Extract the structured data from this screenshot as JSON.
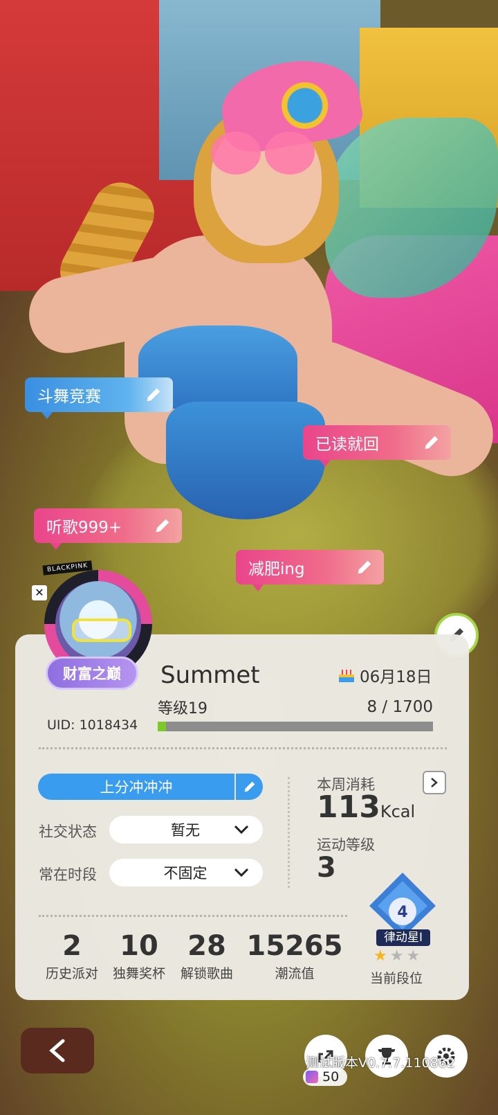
{
  "tags": {
    "tag1": "斗舞竞赛",
    "tag2": "已读就回",
    "tag3": "听歌999+",
    "tag4": "减肥ing"
  },
  "avatar": {
    "brand_text": "BLACKPINK"
  },
  "profile": {
    "wealth_badge": "财富之巅",
    "name": "Summet",
    "birthday": "06月18日",
    "level_label": "等级19",
    "xp_text": "8 / 1700",
    "xp_progress": 0.005,
    "uid_label": "UID:",
    "uid_value": "1018434"
  },
  "status": {
    "motto": "上分冲冲冲",
    "social_label": "社交状态",
    "social_value": "暂无",
    "online_label": "常在时段",
    "online_value": "不固定"
  },
  "fitness": {
    "weekly_label": "本周消耗",
    "weekly_value": "113",
    "weekly_unit": "Kcal",
    "sport_label": "运动等级",
    "sport_value": "3"
  },
  "rank": {
    "tier_number": "4",
    "name": "律动星I",
    "stars_filled": 1,
    "stars_total": 3,
    "label": "当前段位"
  },
  "stats": [
    {
      "value": "2",
      "label": "历史派对"
    },
    {
      "value": "10",
      "label": "独舞奖杯"
    },
    {
      "value": "28",
      "label": "解锁歌曲"
    },
    {
      "value": "15265",
      "label": "潮流值"
    }
  ],
  "footer": {
    "watermark": "测试版本V0.7.7.110862",
    "coin_value": "50"
  },
  "colors": {
    "accent_blue": "#3a9cef",
    "xp_green": "#7ec92a",
    "tag_pink": "#e9458b",
    "tag_blue": "#3a8fe0"
  }
}
